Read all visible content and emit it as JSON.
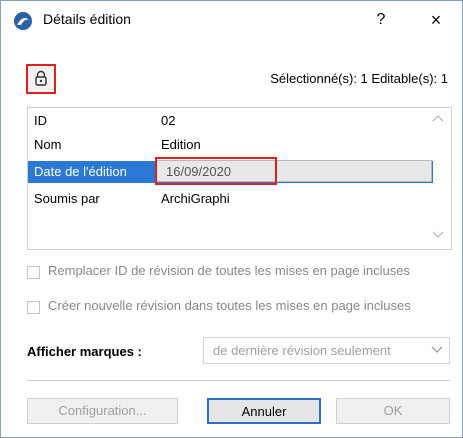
{
  "window": {
    "title": "Détails édition",
    "help_label": "?",
    "close_label": "×"
  },
  "toolbar": {
    "selection_info": "Sélectionné(s): 1 Editable(s): 1"
  },
  "properties": [
    {
      "key": "ID",
      "value": "02"
    },
    {
      "key": "Nom",
      "value": "Edition"
    },
    {
      "key": "Date de l'édition",
      "value": "16/09/2020"
    },
    {
      "key": "Soumis par",
      "value": "ArchiGraphi"
    }
  ],
  "options": {
    "replace_id_label": "Remplacer ID de révision de toutes les mises en page incluses",
    "new_revision_label": "Créer nouvelle révision dans toutes les mises en page incluses",
    "show_marks_label": "Afficher marques :",
    "show_marks_value": "de dernière révision seulement"
  },
  "buttons": {
    "configuration": "Configuration...",
    "cancel": "Annuler",
    "ok": "OK"
  },
  "colors": {
    "selection": "#2b79d6",
    "highlight": "#e02020",
    "default_button_border": "#2a6fce"
  },
  "icons": {
    "app": "archicad-icon",
    "lock": "lock-icon",
    "scroll_up": "chevron-up-icon",
    "scroll_down": "chevron-down-icon",
    "dropdown": "chevron-down-icon"
  }
}
